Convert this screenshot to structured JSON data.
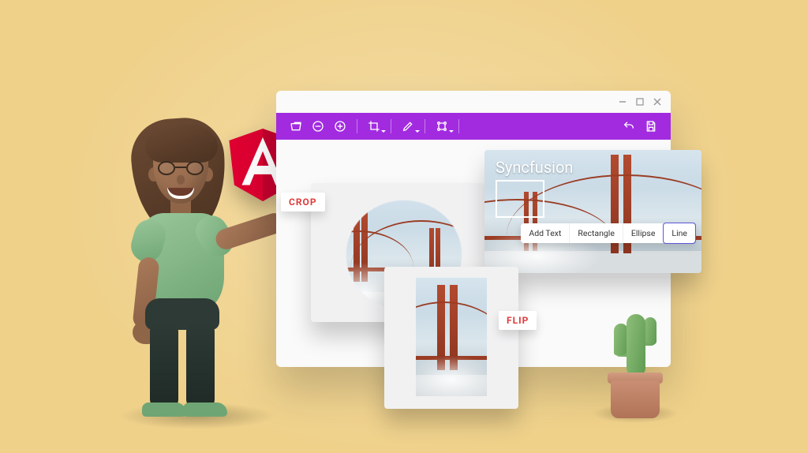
{
  "window": {
    "controls": {
      "min": "minimize",
      "max": "maximize",
      "close": "close"
    }
  },
  "toolbar": {
    "items": [
      {
        "name": "open-icon"
      },
      {
        "name": "zoom-out-icon"
      },
      {
        "name": "zoom-in-icon"
      },
      {
        "name": "sep"
      },
      {
        "name": "crop-icon",
        "dropdown": true
      },
      {
        "name": "sep"
      },
      {
        "name": "annotate-icon",
        "dropdown": true
      },
      {
        "name": "sep"
      },
      {
        "name": "transform-icon",
        "dropdown": true
      },
      {
        "name": "sep"
      },
      {
        "name": "spacer"
      },
      {
        "name": "undo-icon"
      },
      {
        "name": "save-icon"
      }
    ]
  },
  "tags": {
    "crop": "CROP",
    "flip": "FLIP"
  },
  "annotation": {
    "title": "Syncfusion",
    "options": [
      {
        "label": "Add Text",
        "selected": false
      },
      {
        "label": "Rectangle",
        "selected": false
      },
      {
        "label": "Ellipse",
        "selected": false
      },
      {
        "label": "Line",
        "selected": true
      }
    ]
  },
  "framework": "Angular"
}
